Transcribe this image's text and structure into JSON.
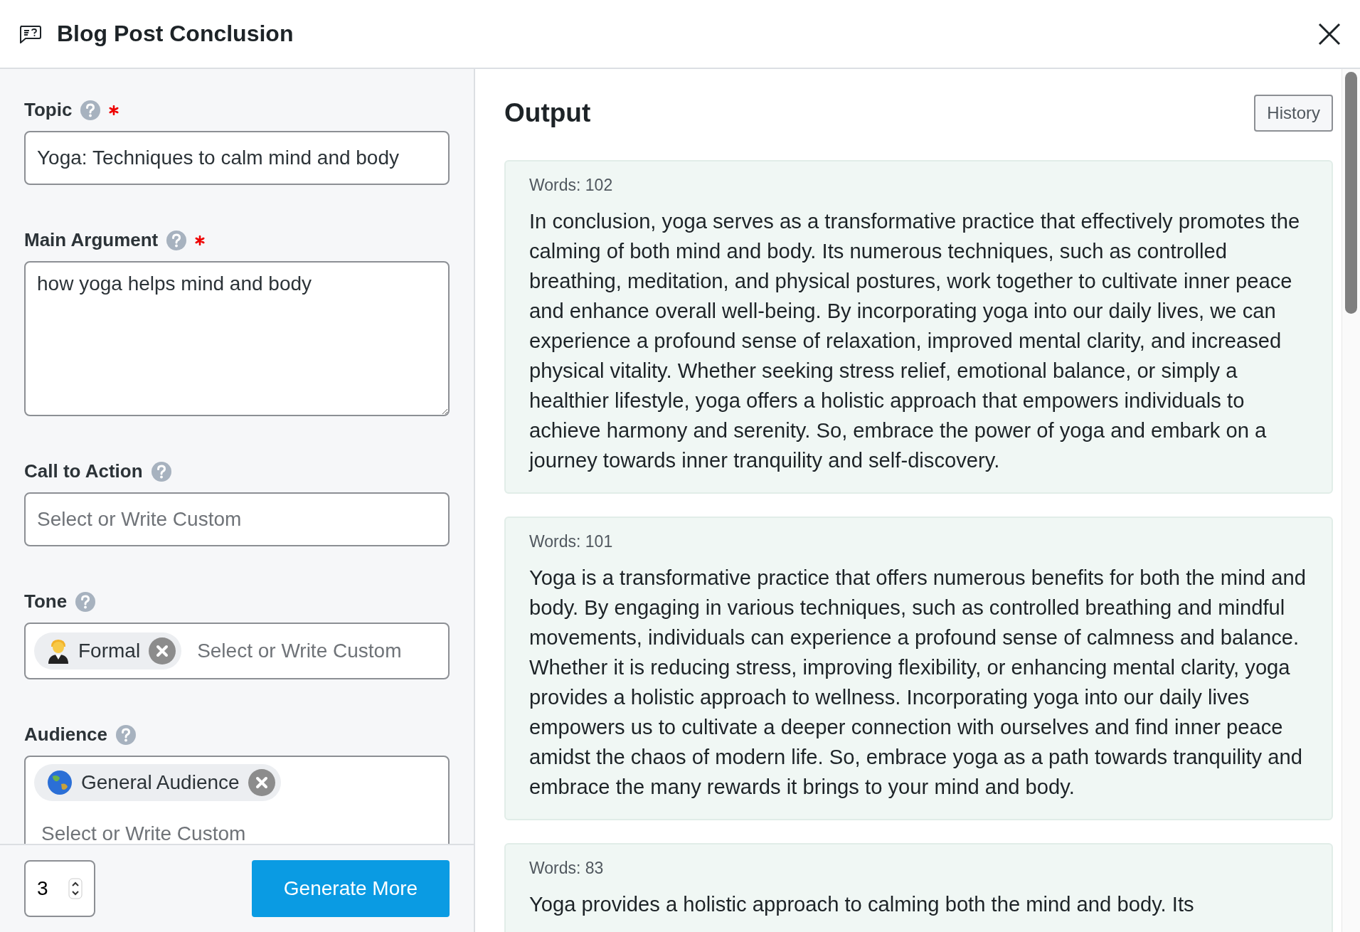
{
  "window": {
    "title": "Blog Post Conclusion"
  },
  "form": {
    "fields": [
      {
        "kind": "text",
        "label": "Topic",
        "required": true,
        "value": "Yoga: Techniques to calm mind and body"
      },
      {
        "kind": "textarea",
        "label": "Main Argument",
        "required": true,
        "value": "how yoga helps mind and body"
      },
      {
        "kind": "text",
        "label": "Call to Action",
        "placeholder": "Select or Write Custom"
      },
      {
        "kind": "tags",
        "label": "Tone",
        "tags": [
          "Formal"
        ],
        "placeholder": "Select or Write Custom",
        "stacked": false
      },
      {
        "kind": "tags",
        "label": "Audience",
        "tags": [
          "General Audience"
        ],
        "placeholder": "Select or Write Custom",
        "stacked": true
      }
    ],
    "count": "3",
    "button": "Generate More"
  },
  "output": {
    "title": "Output",
    "history_button": "History",
    "results": [
      {
        "words": "Words: 102",
        "text": "In conclusion, yoga serves as a transformative practice that effectively promotes the calming of both mind and body. Its numerous techniques, such as controlled breathing, meditation, and physical postures, work together to cultivate inner peace and enhance overall well-being. By incorporating yoga into our daily lives, we can experience a profound sense of relaxation, improved mental clarity, and increased physical vitality. Whether seeking stress relief, emotional balance, or simply a healthier lifestyle, yoga offers a holistic approach that empowers individuals to achieve harmony and serenity. So, embrace the power of yoga and embark on a journey towards inner tranquility and self-discovery."
      },
      {
        "words": "Words: 101",
        "text": "Yoga is a transformative practice that offers numerous benefits for both the mind and body. By engaging in various techniques, such as controlled breathing and mindful movements, individuals can experience a profound sense of calmness and balance. Whether it is reducing stress, improving flexibility, or enhancing mental clarity, yoga provides a holistic approach to wellness. Incorporating yoga into our daily lives empowers us to cultivate a deeper connection with ourselves and find inner peace amidst the chaos of modern life. So, embrace yoga as a path towards tranquility and embrace the many rewards it brings to your mind and body."
      },
      {
        "words": "Words: 83",
        "text": "Yoga provides a holistic approach to calming both the mind and body. Its"
      }
    ]
  }
}
